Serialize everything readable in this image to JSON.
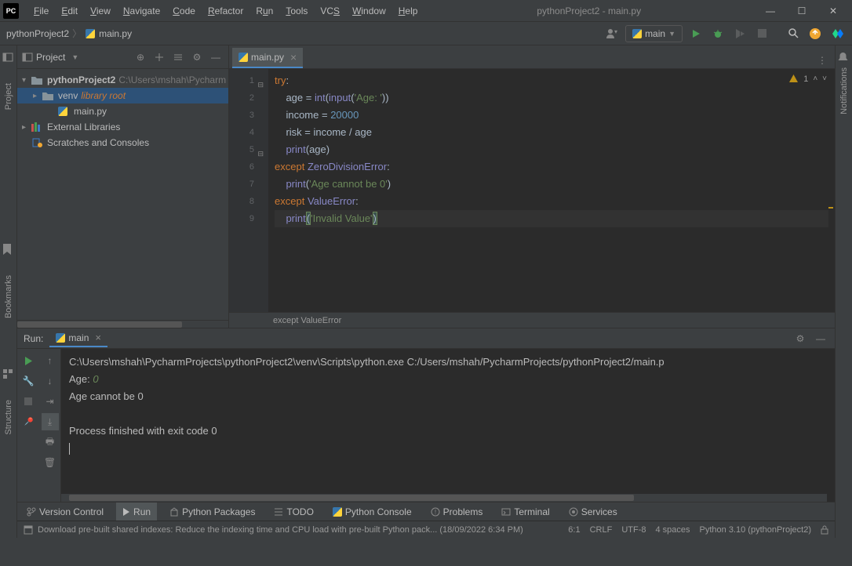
{
  "title": "pythonProject2 - main.py",
  "menu": [
    "File",
    "Edit",
    "View",
    "Navigate",
    "Code",
    "Refactor",
    "Run",
    "Tools",
    "VCS",
    "Window",
    "Help"
  ],
  "menu_underline": [
    "F",
    "E",
    "V",
    "N",
    "C",
    "R",
    "u",
    "T",
    "S",
    "W",
    "H"
  ],
  "breadcrumb": {
    "project": "pythonProject2",
    "file": "main.py"
  },
  "run_config": "main",
  "project_panel": {
    "title": "Project",
    "root": {
      "name": "pythonProject2",
      "path": "C:\\Users\\mshah\\Pycharm"
    },
    "venv": {
      "name": "venv",
      "tag": "library root"
    },
    "mainfile": "main.py",
    "external": "External Libraries",
    "scratches": "Scratches and Consoles"
  },
  "editor": {
    "tab": "main.py",
    "warning_count": "1",
    "breadcrumb": "except ValueError",
    "lines": [
      1,
      2,
      3,
      4,
      5,
      6,
      7,
      8,
      9
    ]
  },
  "run_panel": {
    "label": "Run:",
    "tab": "main",
    "cmd": "C:\\Users\\mshah\\PycharmProjects\\pythonProject2\\venv\\Scripts\\python.exe C:/Users/mshah/PycharmProjects/pythonProject2/main.p",
    "out1": "Age: ",
    "out1_input": "0",
    "out2": "Age cannot be 0",
    "out3": "Process finished with exit code 0"
  },
  "bottom": {
    "vcs": "Version Control",
    "run": "Run",
    "packages": "Python Packages",
    "todo": "TODO",
    "console": "Python Console",
    "problems": "Problems",
    "terminal": "Terminal",
    "services": "Services"
  },
  "status": {
    "msg": "Download pre-built shared indexes: Reduce the indexing time and CPU load with pre-built Python pack... (18/09/2022 6:34 PM)",
    "pos": "6:1",
    "eol": "CRLF",
    "enc": "UTF-8",
    "indent": "4 spaces",
    "interp": "Python 3.10 (pythonProject2)"
  },
  "stripes": {
    "project": "Project",
    "bookmarks": "Bookmarks",
    "structure": "Structure",
    "notifications": "Notifications"
  }
}
